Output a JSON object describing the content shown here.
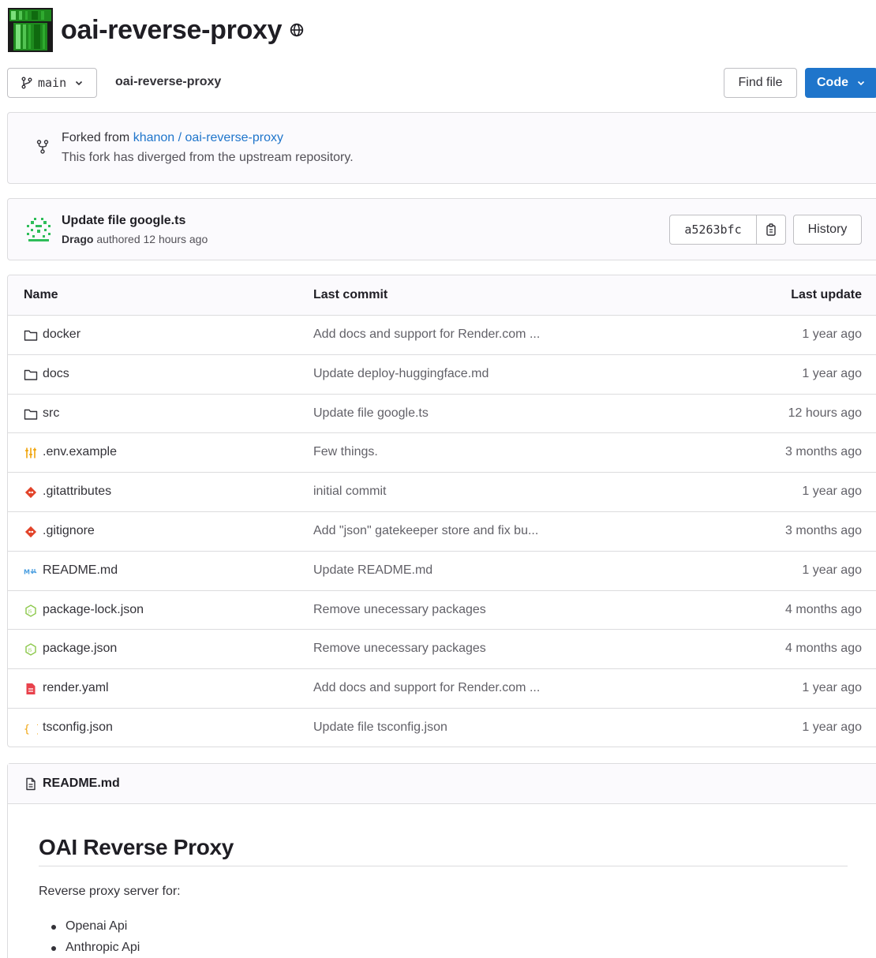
{
  "repo": {
    "title": "oai-reverse-proxy",
    "visibility_icon": "globe-icon"
  },
  "toolbar": {
    "branch": "main",
    "breadcrumb": "oai-reverse-proxy",
    "find_file": "Find file",
    "code": "Code"
  },
  "fork": {
    "prefix": "Forked from ",
    "source": "khanon / oai-reverse-proxy",
    "status": "This fork has diverged from the upstream repository."
  },
  "commit": {
    "message": "Update file google.ts",
    "author": "Drago",
    "meta": " authored 12 hours ago",
    "sha": "a5263bfc",
    "history": "History"
  },
  "files": {
    "headers": {
      "name": "Name",
      "last_commit": "Last commit",
      "last_update": "Last update"
    },
    "rows": [
      {
        "icon": "folder-icon",
        "name": "docker",
        "commit": "Add docs and support for Render.com ...",
        "date": "1 year ago"
      },
      {
        "icon": "folder-icon",
        "name": "docs",
        "commit": "Update deploy-huggingface.md",
        "date": "1 year ago"
      },
      {
        "icon": "folder-icon",
        "name": "src",
        "commit": "Update file google.ts",
        "date": "12 hours ago"
      },
      {
        "icon": "env-file-icon",
        "name": ".env.example",
        "commit": "Few things.",
        "date": "3 months ago"
      },
      {
        "icon": "git-icon",
        "name": ".gitattributes",
        "commit": "initial commit",
        "date": "1 year ago"
      },
      {
        "icon": "git-icon",
        "name": ".gitignore",
        "commit": "Add \"json\" gatekeeper store and fix bu...",
        "date": "3 months ago"
      },
      {
        "icon": "markdown-icon",
        "name": "README.md",
        "commit": "Update README.md",
        "date": "1 year ago"
      },
      {
        "icon": "nodejs-icon",
        "name": "package-lock.json",
        "commit": "Remove unecessary packages",
        "date": "4 months ago"
      },
      {
        "icon": "nodejs-icon",
        "name": "package.json",
        "commit": "Remove unecessary packages",
        "date": "4 months ago"
      },
      {
        "icon": "yaml-file-icon",
        "name": "render.yaml",
        "commit": "Add docs and support for Render.com ...",
        "date": "1 year ago"
      },
      {
        "icon": "json-icon",
        "name": "tsconfig.json",
        "commit": "Update file tsconfig.json",
        "date": "1 year ago"
      }
    ]
  },
  "readme": {
    "filename": "README.md",
    "heading": "OAI Reverse Proxy",
    "intro": "Reverse proxy server for:",
    "items": [
      "Openai Api",
      "Anthropic Api"
    ]
  },
  "colors": {
    "link": "#1f75cb",
    "primary_button": "#1f75cb",
    "git_icon": "#e24329",
    "env_icon": "#f0a30a",
    "node_icon": "#8cc84b",
    "yaml_icon": "#e8424c",
    "markdown_icon": "#4a9ee0"
  }
}
